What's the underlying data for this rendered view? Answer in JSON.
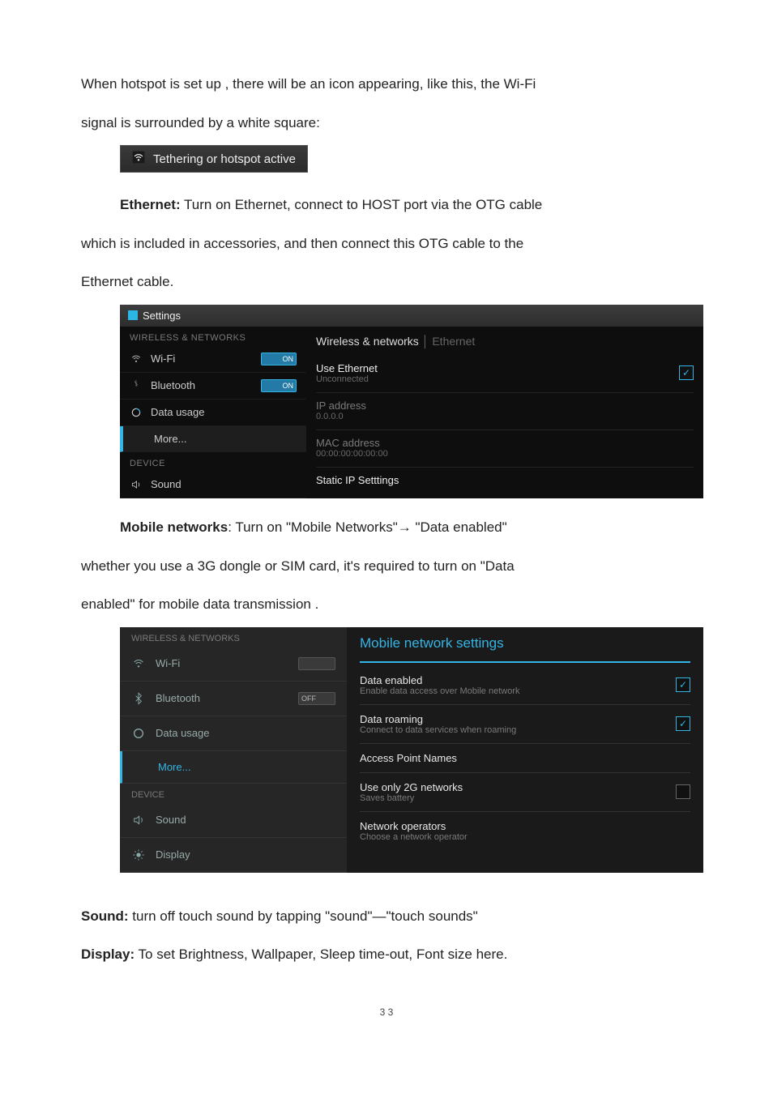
{
  "p1a": "When hotspot is set up , there will be an icon appearing, like this, the Wi-Fi",
  "p1b": "signal is surrounded by a white square:",
  "hotspot_label": "Tethering or hotspot active",
  "p2_strong": "Ethernet:",
  "p2a": " Turn on Ethernet, connect to HOST port via the OTG cable",
  "p2b": "which is included in accessories, and then connect this OTG cable to the",
  "p2c": "Ethernet cable.",
  "ss1": {
    "title": "Settings",
    "cat_wn": "WIRELESS & NETWORKS",
    "wifi": "Wi-Fi",
    "on": "ON",
    "bt": "Bluetooth",
    "du": "Data usage",
    "more": "More...",
    "cat_dev": "DEVICE",
    "sound": "Sound",
    "bc_a": "Wireless & networks",
    "bc_sep": " │ ",
    "bc_b": "Ethernet",
    "use_eth_t": "Use Ethernet",
    "use_eth_s": "Unconnected",
    "ip_t": "IP address",
    "ip_s": "0.0.0.0",
    "mac_t": "MAC address",
    "mac_s": "00:00:00:00:00:00",
    "static_t": "Static IP Setttings"
  },
  "p3_strong": "Mobile networks",
  "p3a": ": Turn on \"Mobile Networks\"→ \"Data enabled\"",
  "p3b": "whether you use a 3G dongle or SIM card, it's required to turn on   \"Data",
  "p3c": "enabled\" for mobile data transmission .",
  "ss2": {
    "cat_wn": "WIRELESS & NETWORKS",
    "wifi": "Wi-Fi",
    "bt": "Bluetooth",
    "off": "OFF",
    "du": "Data usage",
    "more": "More...",
    "cat_dev": "DEVICE",
    "sound": "Sound",
    "display": "Display",
    "title": "Mobile network settings",
    "de_t": "Data enabled",
    "de_s": "Enable data access over Mobile network",
    "dr_t": "Data roaming",
    "dr_s": "Connect to data services when roaming",
    "apn_t": "Access Point Names",
    "u2g_t": "Use only 2G networks",
    "u2g_s": "Saves battery",
    "no_t": "Network operators",
    "no_s": "Choose a network operator"
  },
  "p4_strong": "Sound:",
  "p4": " turn off touch sound by tapping \"sound\"—\"touch sounds\"",
  "p5_strong": "Display:",
  "p5": " To set Brightness, Wallpaper, Sleep time-out, Font size here.",
  "page_num": "3 3"
}
